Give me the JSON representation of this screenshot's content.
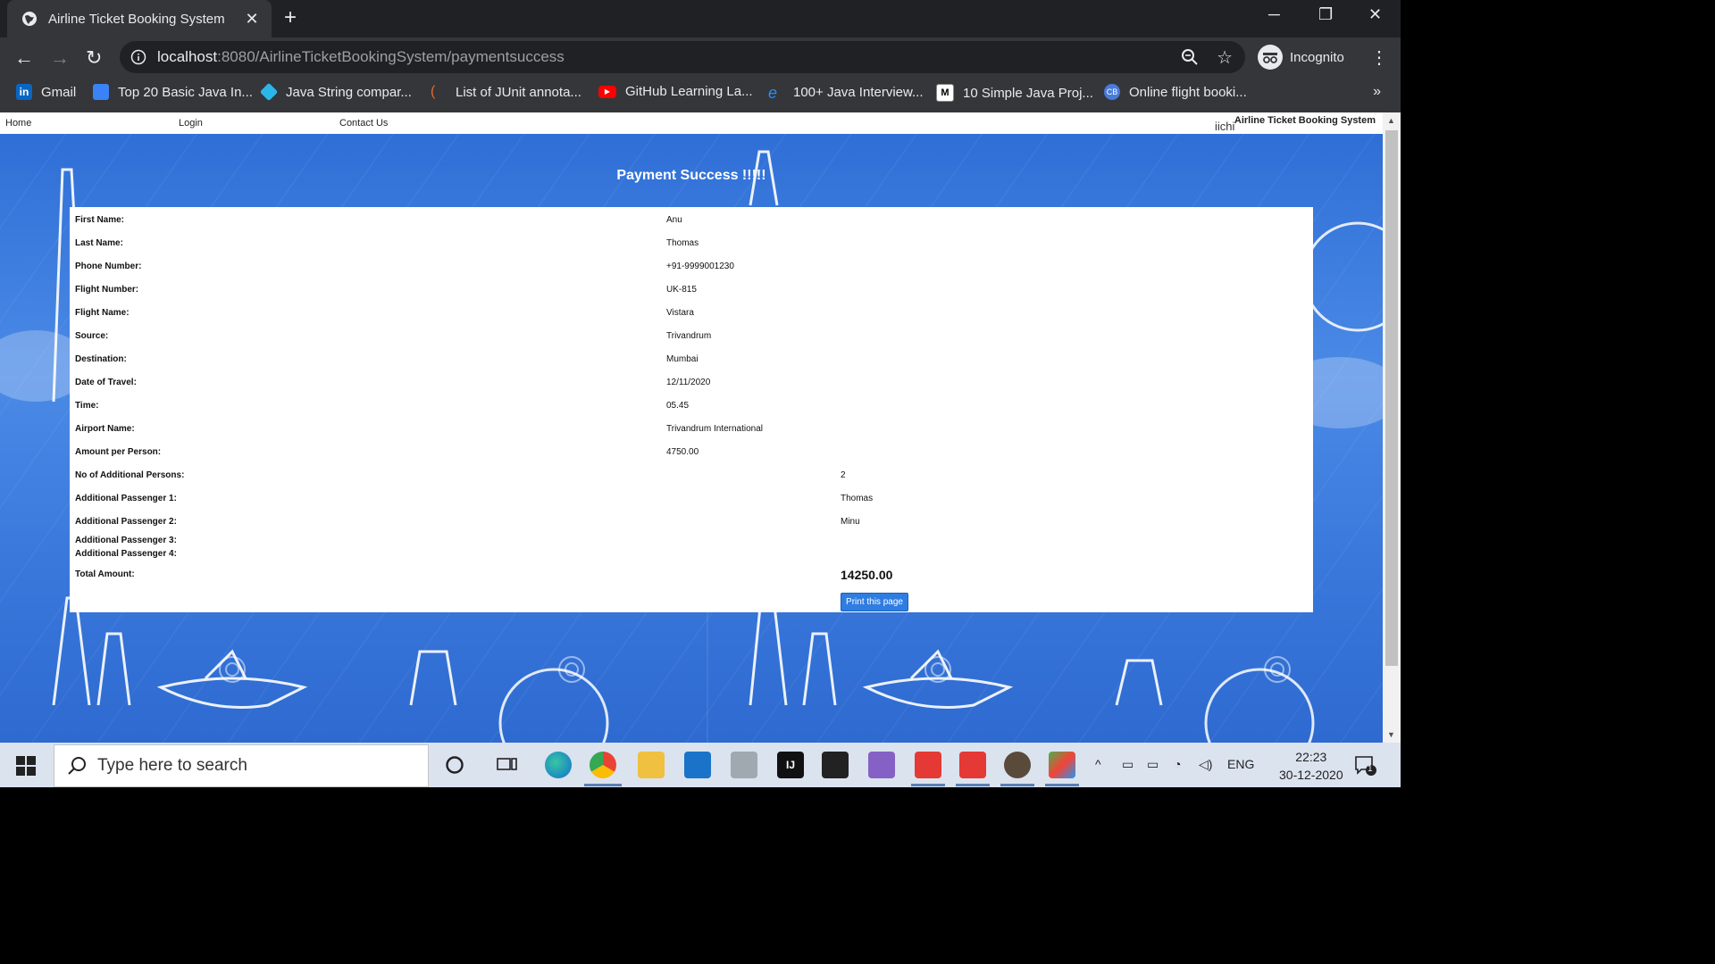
{
  "browser": {
    "tab_title": "Airline Ticket Booking System",
    "url_host": "localhost",
    "url_rest": ":8080/AirlineTicketBookingSystem/paymentsuccess",
    "profile_label": "Incognito",
    "bookmarks": [
      {
        "label": "Gmail",
        "icon": "linkedin-icon",
        "color": "#0a66c2"
      },
      {
        "label": "Top 20 Basic Java In...",
        "icon": "doc-icon",
        "color": "#3b82f6"
      },
      {
        "label": "Java String compar...",
        "icon": "diamond-icon",
        "color": "#2bb6e8"
      },
      {
        "label": "List of JUnit annota...",
        "icon": "feather-icon",
        "color": "#e86a2b"
      },
      {
        "label": "GitHub Learning La...",
        "icon": "youtube-icon",
        "color": "#ff0000"
      },
      {
        "label": "100+ Java Interview...",
        "icon": "edge-icon",
        "color": "#1e90ff"
      },
      {
        "label": "10 Simple Java Proj...",
        "icon": "medium-icon",
        "color": "#ffffff"
      },
      {
        "label": "Online flight booki...",
        "icon": "cb-icon",
        "color": "#4a7bd8"
      }
    ]
  },
  "site": {
    "nav": {
      "home": "Home",
      "login": "Login",
      "contact": "Contact Us"
    },
    "brand": "Airline Ticket Booking System",
    "brand_logo_text": "iichi",
    "headline": "Payment Success !!!!!",
    "details": [
      {
        "label": "First Name:",
        "value": "Anu"
      },
      {
        "label": "Last Name:",
        "value": "Thomas"
      },
      {
        "label": "Phone Number:",
        "value": "+91-9999001230"
      },
      {
        "label": "Flight Number:",
        "value": "UK-815"
      },
      {
        "label": "Flight Name:",
        "value": "Vistara"
      },
      {
        "label": "Source:",
        "value": "Trivandrum"
      },
      {
        "label": "Destination:",
        "value": "Mumbai"
      },
      {
        "label": "Date of Travel:",
        "value": "12/11/2020"
      },
      {
        "label": "Time:",
        "value": "05.45"
      },
      {
        "label": "Airport Name:",
        "value": "Trivandrum International"
      },
      {
        "label": "Amount per Person:",
        "value": "4750.00"
      }
    ],
    "extra": [
      {
        "label": "No of Additional Persons:",
        "value": "2"
      },
      {
        "label": "Additional Passenger 1:",
        "value": "Thomas"
      },
      {
        "label": "Additional Passenger 2:",
        "value": "Minu"
      },
      {
        "label": "Additional Passenger 3:",
        "value": ""
      },
      {
        "label": "Additional Passenger 4:",
        "value": ""
      }
    ],
    "total_label": "Total Amount:",
    "total_value": "14250.00",
    "print_button": "Print this page"
  },
  "taskbar": {
    "search_placeholder": "Type here to search",
    "lang": "ENG",
    "time": "22:23",
    "date": "30-12-2020",
    "notification_count": "1"
  }
}
